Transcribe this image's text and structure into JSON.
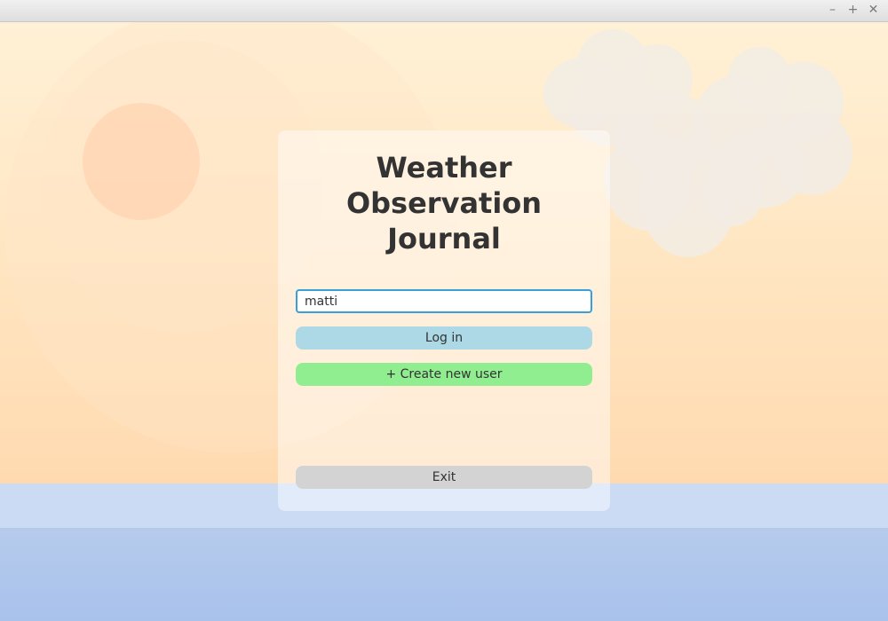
{
  "window": {
    "controls": {
      "minimize_icon": "–",
      "maximize_icon": "+",
      "close_icon": "✕"
    }
  },
  "login": {
    "title": "Weather\nObservation\nJournal",
    "username_value": "matti",
    "login_label": "Log in",
    "create_user_label": "+ Create new user",
    "exit_label": "Exit"
  },
  "colors": {
    "login_button": "#add8e6",
    "create_button": "#90ee90",
    "exit_button": "#d3d3d3",
    "input_focus_border": "#3a9fd8",
    "sky": "#ffe4bf",
    "water": "#cbdbf4"
  }
}
